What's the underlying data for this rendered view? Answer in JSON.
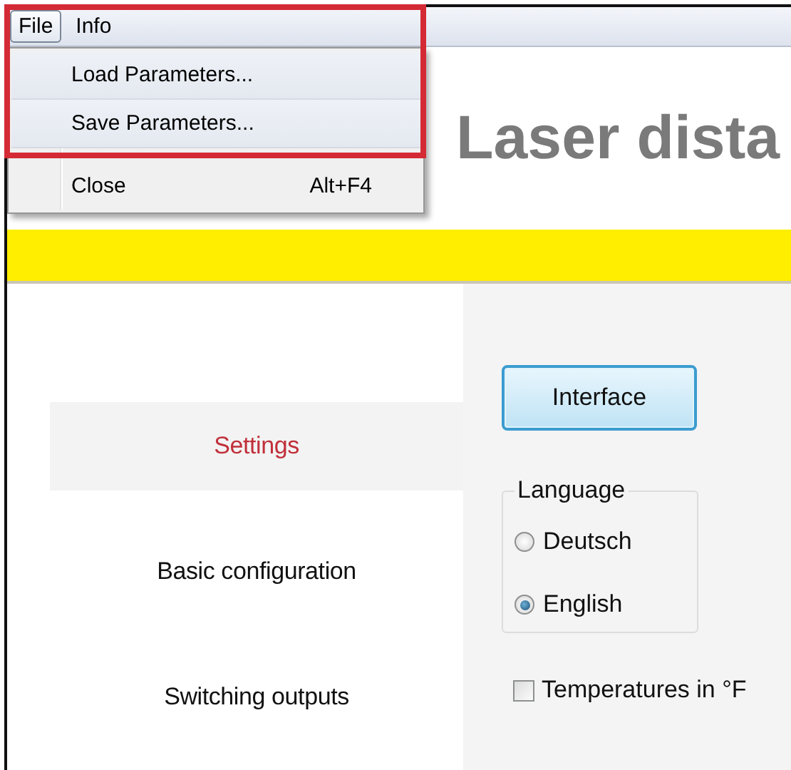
{
  "menu_bar": [
    {
      "label": "File",
      "selected": true
    },
    {
      "label": "Info",
      "selected": false
    }
  ],
  "file_menu": [
    {
      "kind": "item",
      "label": "Load Parameters..."
    },
    {
      "kind": "item",
      "label": "Save Parameters..."
    },
    {
      "kind": "separator"
    },
    {
      "kind": "item",
      "label": "Close",
      "shortcut": "Alt+F4"
    }
  ],
  "title": "Laser dista",
  "nav": [
    {
      "label": "Settings",
      "selected": true
    },
    {
      "label": "Basic configuration",
      "selected": false
    },
    {
      "label": "Switching outputs",
      "selected": false
    }
  ],
  "interface_button": {
    "label": "Interface"
  },
  "language": {
    "legend": "Language",
    "options": [
      {
        "label": "Deutsch",
        "selected": false
      },
      {
        "label": "English",
        "selected": true
      }
    ]
  },
  "temperature_checkbox": {
    "label": "Temperatures in °F",
    "checked": false
  }
}
